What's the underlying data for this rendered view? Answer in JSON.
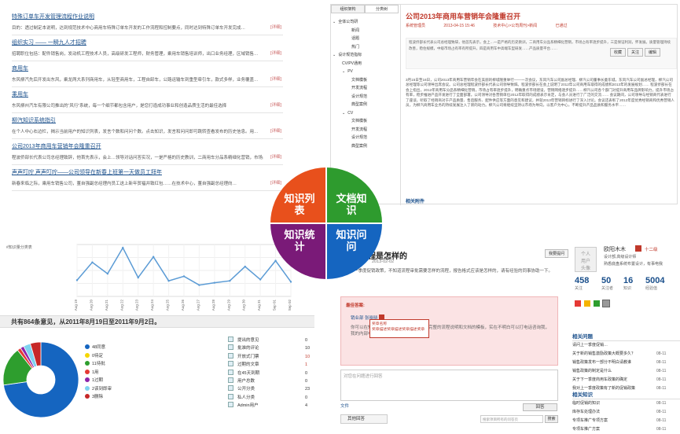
{
  "knowledge_list": {
    "items": [
      {
        "title": "特殊订单车开发管理流程作业说明",
        "desc": "目的：透过制定本说明，达到规范技术中心商用车特殊订单车开发的工作流程和控制要点，同时达到特殊订单车开发完成…",
        "more": "[详细]"
      },
      {
        "title": "组织实习 —— 一瞬九人才招聘",
        "desc": "招聘职位包括：配件销售岗，发动机工程技术人员，高级研发工程师，财务管理，乘用车销售培训师，出口业务经理，区域销售…",
        "more": "[详细]"
      },
      {
        "title": "商用车",
        "desc": "东风柳汽先后开发出东风，乘龙两大系列商用车，从轻型商用车，工程自卸车，公路运输车到重型牵引车，款式多样，业务覆盖…",
        "more": "[详细]"
      },
      {
        "title": "乘用车",
        "desc": "东风柳州汽车有限公司推出的“风行”系统，每一个细节都包含用户，是您打造成功事业和创造品质生活的最佳选择",
        "more": "[详细]"
      },
      {
        "title": "柳汽知识系统指引",
        "desc": "在个人中心右边栏，揭示当前用户的知识列表，发言个数和问问个数。点击知识，发言和问问即可跳转查看发布的历史信息。用…",
        "more": "[详细]"
      },
      {
        "title": "公司2013年商用车营销年会隆重召开",
        "desc": "程波侨部长代表公司总经理致辞，他首先表示，会上…领导对话问答实况，一是严格的历史教训，二商用车分品系精细化营销，市场占有率逐步提升，三是保…",
        "more": "[详细]"
      },
      {
        "title": "声声叮咛 声声叮咛——公司领导在新春上班第一天做员工拜年",
        "desc": "新春来临之际，乘用车销售公司，董自强副总经理内员工送上新年贺福并致红包……在技术中心，董自强副总经理向…",
        "more": "[详细]"
      }
    ]
  },
  "document": {
    "tabs": [
      "组织架构",
      "分类树"
    ],
    "tree": [
      {
        "label": "全体公司研",
        "level": 0,
        "mark": "⌄"
      },
      {
        "label": "新闻",
        "level": 2
      },
      {
        "label": "话题",
        "level": 2
      },
      {
        "label": "热门",
        "level": 2
      },
      {
        "label": "设计规范指标",
        "level": 0,
        "mark": "⌄"
      },
      {
        "label": "CV/PV通用",
        "level": 1
      },
      {
        "label": "PV",
        "level": 1,
        "mark": "⌄"
      },
      {
        "label": "文档模板",
        "level": 2
      },
      {
        "label": "开发流程",
        "level": 2
      },
      {
        "label": "设计规范",
        "level": 2
      },
      {
        "label": "典型案例",
        "level": 2
      },
      {
        "label": "CV",
        "level": 1,
        "mark": "⌄"
      },
      {
        "label": "文档模板",
        "level": 2
      },
      {
        "label": "开发流程",
        "level": 2
      },
      {
        "label": "设计规范",
        "level": 2
      },
      {
        "label": "典型案例",
        "level": 2
      }
    ],
    "title": "公司2013年商用车营销年会隆重召开",
    "meta": [
      "系统管理员",
      "2013-04-15 15:46",
      "技术中心>公司周刊>新闻",
      "已通过"
    ],
    "abstract": "程波侨部长代表公司总经理致辞，他首先表示，会上…一是严格的历史教训，二商用车分品系精细化营销，市场占有率逐步提升，三是保证利润，怀发展。质量管理持续改善，稳住规模，中级市场占有率有所提升，四是商用车中高端车型研发……产品质量平台……",
    "actions": [
      "收藏",
      "关注",
      "编辑"
    ],
    "body": "3月15日至16日，公司2013年商用车营销年会在美丽的柳城隆重举行——一次会议，东风汽车公司副总经理、柳汽公司董事长童东城，东风汽车公司副总经理，柳汽公司总经理等公司领导出席会议。公司总经理程波侨部长代表公司领导致辞。程波侨部长在会上说明了2012年公司商用车取得的成绩和2013年的发展规划…… 程波侨部长在会上指出，2012年商用车分品系精细化营销，市场占有率逐步提升，明确重点市场建设，营销网络逐步提升……柳汽公司各个部门对提升商用车品牌影响力，提升市场占有率，稳步推进产品开发进行了全面部署。公司领导对各营销单位2012年取得的成绩表示肯定，与会人员进行了广泛的交流…… 会议期间，公司领导与经销商代表进行了座谈，听取了经销商对于产品质量、售后服务、配件供应等方面的意见和建议，并就2013年营销目标进行了深入讨论。会议还表彰了2012年度优秀经销商和优秀营销人员，为柳汽商用车业务的持续发展注入了新的动力。柳汽公司将继续坚持以市场为导向，以客户为中心，不断提升产品品质和服务水平……",
    "attachments": "相关附件"
  },
  "statistics": {
    "tag_label": "#知识量分类表",
    "summary": "共有864条意见，从2011年8月19日至2011年9月2日。",
    "legend": [
      {
        "label": "48同意",
        "color": "#1565c0"
      },
      {
        "label": "0待定",
        "color": "#f5d600"
      },
      {
        "label": "11待批",
        "color": "#2e9e2e"
      },
      {
        "label": "1用",
        "color": "#e53935"
      },
      {
        "label": "1过期",
        "color": "#8e24aa"
      },
      {
        "label": "2该到即审",
        "color": "#7fd3f0"
      },
      {
        "label": "3删除",
        "color": "#c62828"
      }
    ],
    "services": [
      {
        "label": "提出的意见",
        "value": "0"
      },
      {
        "label": "批准的评论",
        "value": "10"
      },
      {
        "label": "开放式门票",
        "value": "10"
      },
      {
        "label": "过期的文章",
        "value": "1"
      },
      {
        "label": "在45天到期",
        "value": "0"
      },
      {
        "label": "用户总数",
        "value": "0"
      },
      {
        "label": "公开分类",
        "value": "23"
      },
      {
        "label": "私人分类",
        "value": "0"
      },
      {
        "label": "Admin用户",
        "value": "4"
      }
    ]
  },
  "quadrant": {
    "items": [
      {
        "label": "知识列\n表",
        "color": "#e8501c"
      },
      {
        "label": "文档知\n识",
        "color": "#2e9b2e"
      },
      {
        "label": "知识统\n计",
        "color": "#7a1a78"
      },
      {
        "label": "知识问\n问",
        "color": "#1565c0"
      }
    ]
  },
  "qa": {
    "title": "策审批流程是怎样的",
    "date": "2013-02-02",
    "body": "在制定下一季度促销政策，不知道流程审批需要怎样的流程，报告格式应该是怎样的，请有经验的同事协助一下。",
    "ask_button": "我要提问",
    "best_label": "最佳答案:",
    "best_user": "销业部 张晓晓",
    "best_text": "你可以在知识库中搜索一下促销政策，有完整的流程说明和文档的模板，实在不明白可以打电话咨询我，我的内部电话是6666666",
    "answer_placeholder": "对您在问题进行回答",
    "file_label": "文件",
    "answer_button": "回答",
    "other_tab": "其他回答",
    "search_placeholder": "搜索项目所有的问答页",
    "search_button": "搜索",
    "profile": {
      "avatar_text": "个人\n用户\n头像",
      "name": "欧阳木木",
      "level": "十二级",
      "dept": "设计部,高级设计师",
      "desc": "熟悉底盘系统布置设计，有事电我",
      "stats": [
        {
          "value": "458",
          "label": "关注"
        },
        {
          "value": "50",
          "label": "关注者"
        },
        {
          "value": "16",
          "label": "知识"
        },
        {
          "value": "5004",
          "label": "经验值"
        }
      ],
      "tooltip": "奖章名称\n奖章描述奖章描述奖章描述奖章"
    },
    "related_questions": {
      "title": "相关问题",
      "rows": [
        {
          "text": "请问上一季度促销…",
          "date": ""
        },
        {
          "text": "关于新的销售激励政策大概要多久？",
          "date": "08-11"
        },
        {
          "text": "销售政策发布一部分不明白请教谁",
          "date": "08-11"
        },
        {
          "text": "销售政策的制定是什么",
          "date": "08-11"
        },
        {
          "text": "关于下一季度商用车政策的确定",
          "date": "08-11"
        },
        {
          "text": "我对上一季度政策有了新的促销政策",
          "date": "08-11"
        }
      ]
    },
    "related_knowledge": {
      "title": "相关知识",
      "rows": [
        {
          "text": "临时促销的知识",
          "date": "08-11"
        },
        {
          "text": "库存车处理办法",
          "date": "08-11"
        },
        {
          "text": "专项车推广专项方案",
          "date": "08-11"
        },
        {
          "text": "专项车推广方案",
          "date": "08-11"
        }
      ]
    }
  },
  "chart_data": [
    {
      "type": "line",
      "x": [
        "Aug 19",
        "Aug 20",
        "Aug 21",
        "Aug 22",
        "Aug 23",
        "Aug 24",
        "Aug 25",
        "Aug 26",
        "Aug 27",
        "Aug 28",
        "Aug 29",
        "Aug 30",
        "Aug 31",
        "Sep 01",
        "Sep 02"
      ],
      "series": [
        {
          "values": [
            50,
            105,
            70,
            150,
            58,
            122,
            48,
            62,
            35,
            42,
            48,
            92,
            52,
            110,
            45
          ]
        }
      ],
      "ylim": [
        0,
        160
      ],
      "grid": true
    },
    {
      "type": "pie",
      "categories": [
        "48同意",
        "0待定",
        "11待批",
        "1用",
        "1过期",
        "2该到即审",
        "3删除"
      ],
      "values": [
        48,
        0,
        11,
        1,
        1,
        2,
        3
      ]
    }
  ]
}
